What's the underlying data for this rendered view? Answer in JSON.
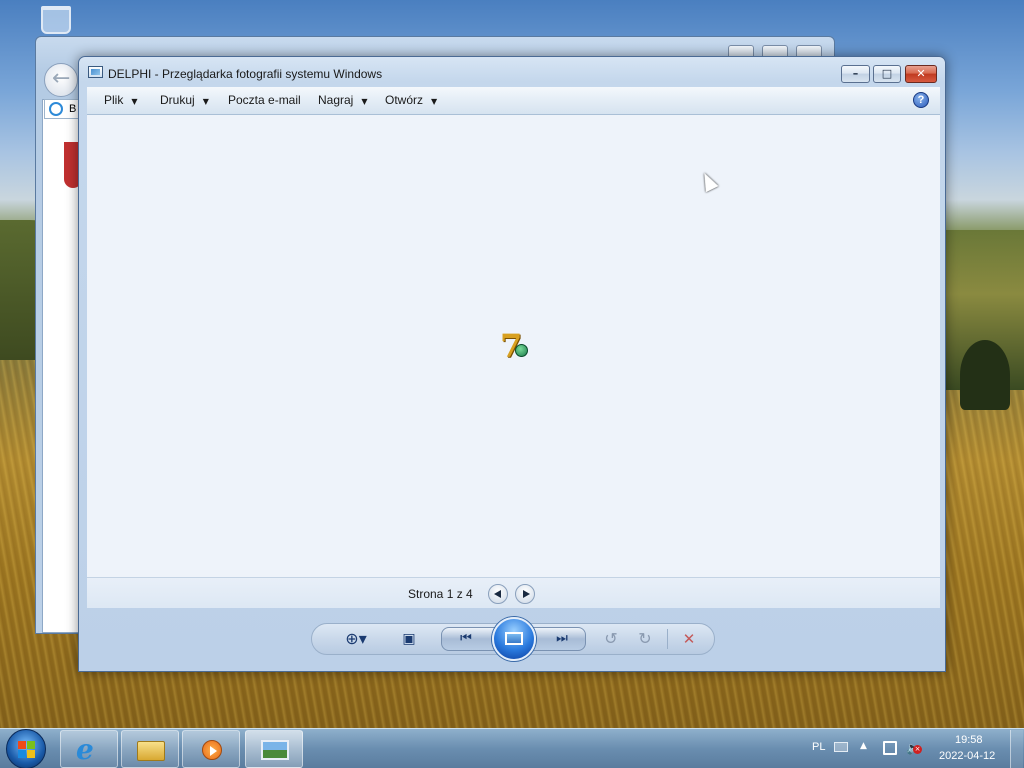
{
  "desktop": {
    "recycle_bin_icon": "recycle-bin-icon"
  },
  "background_window": {
    "tab_label": "B"
  },
  "window": {
    "title": "DELPHI - Przeglądarka fotografii systemu Windows",
    "minimize_glyph": "–",
    "maximize_glyph": "□",
    "close_glyph": "✕"
  },
  "toolbar": {
    "items": [
      {
        "label": "Plik",
        "has_dropdown": true
      },
      {
        "label": "Drukuj",
        "has_dropdown": true
      },
      {
        "label": "Poczta e-mail",
        "has_dropdown": false
      },
      {
        "label": "Nagraj",
        "has_dropdown": true
      },
      {
        "label": "Otwórz",
        "has_dropdown": true
      }
    ],
    "help_label": "?"
  },
  "viewer": {
    "image_icon": "windows-7-logo-icon"
  },
  "pagebar": {
    "page_text": "Strona 1 z 4"
  },
  "controls": {
    "zoom_glyph": "⊕▾",
    "fit_glyph": "▣",
    "prev_glyph": "⏮",
    "next_glyph": "⏭",
    "rotate_left_glyph": "↺",
    "rotate_right_glyph": "↻",
    "delete_glyph": "✕"
  },
  "taskbar": {
    "buttons": [
      "internet-explorer",
      "windows-explorer",
      "media-player",
      "photo-viewer"
    ],
    "active": "photo-viewer",
    "tray": {
      "language": "PL",
      "time": "19:58",
      "date": "2022-04-12"
    }
  }
}
